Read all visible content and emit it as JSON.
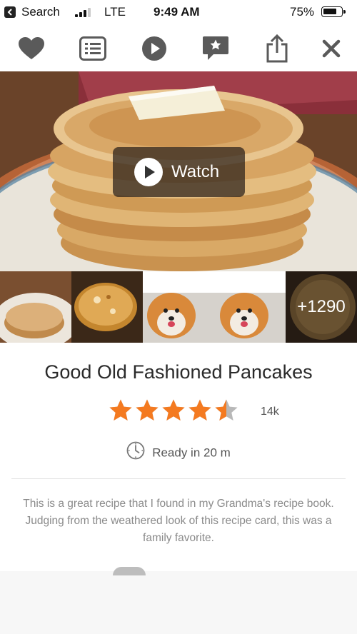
{
  "status_bar": {
    "back_label": "Search",
    "carrier": "LTE",
    "time": "9:49 AM",
    "battery": "75%",
    "battery_level": 0.75
  },
  "toolbar": {
    "icons": [
      "heart-icon",
      "list-icon",
      "play-icon",
      "featured-icon",
      "share-icon",
      "close-icon"
    ]
  },
  "hero": {
    "watch_label": "Watch"
  },
  "thumbnails": {
    "more_count": "+1290"
  },
  "recipe": {
    "title": "Good Old Fashioned Pancakes",
    "rating": 4.5,
    "rating_max": 5,
    "rating_count": "14k",
    "ready_text": "Ready in 20 m",
    "description": "This is a great recipe that I found in my Grandma's recipe book. Judging from the weathered look of this recipe card, this was a family favorite."
  },
  "colors": {
    "star": "#f47a20",
    "star_empty": "#b8b8b8",
    "icon": "#5a5a5a"
  }
}
